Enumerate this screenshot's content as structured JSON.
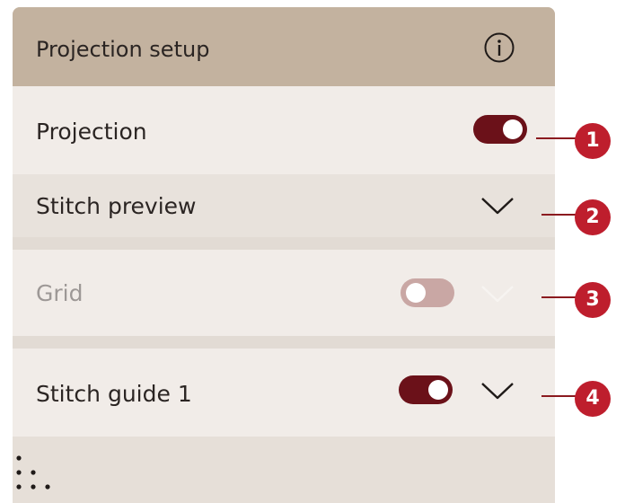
{
  "panel": {
    "title": "Projection setup",
    "info_icon": "info-circle-icon",
    "colors": {
      "header_bg": "#c3b29f",
      "toggle_on": "#6b1119",
      "toggle_off": "#c9a7a4",
      "callout": "#be1e2d"
    }
  },
  "rows": [
    {
      "label": "Projection",
      "toggle": true
    },
    {
      "label": "Stitch preview",
      "expand_icon": "chevron-down-icon"
    },
    {
      "label": "Grid",
      "toggle": false,
      "disabled": true,
      "expand_icon": "chevron-down-icon"
    },
    {
      "label": "Stitch guide 1",
      "toggle": true,
      "expand_icon": "chevron-down-icon"
    }
  ],
  "footer": {
    "icon": "drag-handle-dots-icon"
  },
  "callouts": [
    "1",
    "2",
    "3",
    "4"
  ]
}
